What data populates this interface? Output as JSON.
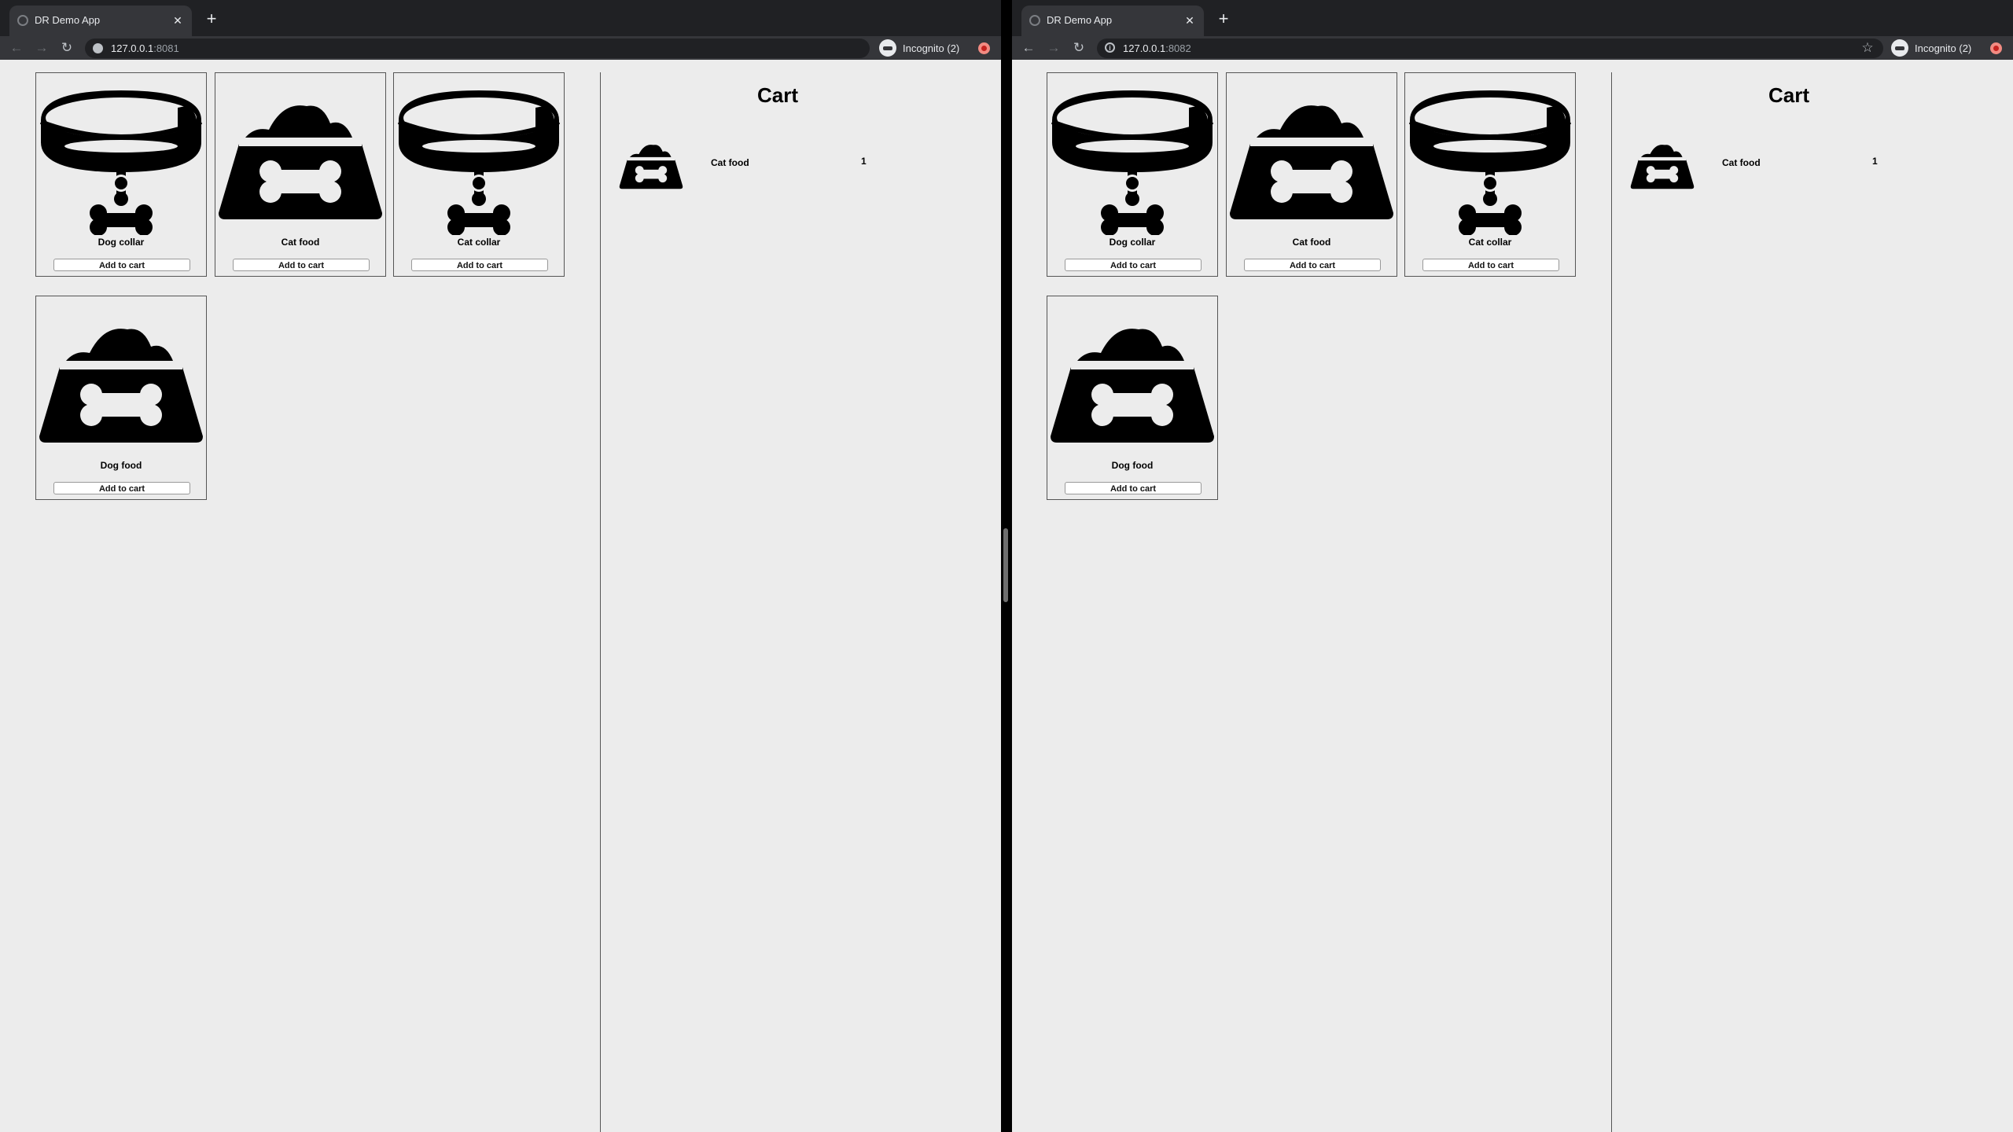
{
  "windows": [
    {
      "tab_title": "DR Demo App",
      "url_host": "127.0.0.1",
      "url_port": ":8081",
      "incognito_label": "Incognito (2)"
    },
    {
      "tab_title": "DR Demo App",
      "url_host": "127.0.0.1",
      "url_port": ":8082",
      "incognito_label": "Incognito (2)"
    }
  ],
  "products": [
    {
      "name": "Dog collar",
      "icon": "collar-icon",
      "button": "Add to cart"
    },
    {
      "name": "Cat food",
      "icon": "food-bowl-icon",
      "button": "Add to cart"
    },
    {
      "name": "Cat collar",
      "icon": "collar-icon",
      "button": "Add to cart"
    },
    {
      "name": "Dog food",
      "icon": "food-bowl-icon",
      "button": "Add to cart"
    }
  ],
  "cart": {
    "title": "Cart",
    "items": [
      {
        "name": "Cat food",
        "quantity": "1",
        "icon": "food-bowl-icon"
      }
    ]
  },
  "icons": {
    "back": "←",
    "forward": "→",
    "reload": "↻",
    "close": "✕",
    "new_tab": "+",
    "star": "☆"
  },
  "colors": {
    "tabstrip": "#202124",
    "toolbar": "#35363a",
    "page_bg": "#ececec",
    "profile": "#f28b82"
  }
}
